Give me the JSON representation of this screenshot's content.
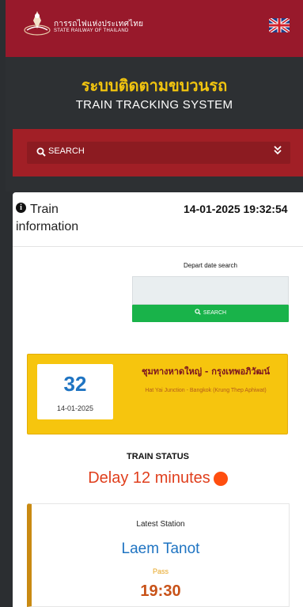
{
  "header": {
    "brand_th": "การรถไฟแห่งประเทศไทย",
    "brand_en": "STATE RAILWAY OF THAILAND",
    "logo_icon": "srt-logo",
    "lang_icon": "uk-flag-icon",
    "bar_color": "#98192b"
  },
  "hero": {
    "title_th": "ระบบติดตามขบวนรถ",
    "title_en": "TRAIN TRACKING SYSTEM",
    "title_color": "#f1c40f"
  },
  "search": {
    "label": "SEARCH",
    "icon": "search-icon",
    "toggle_icon": "double-chevron-down-icon"
  },
  "info": {
    "title": "Train information",
    "datetime": "14-01-2025 19:32:54",
    "icon": "info-circle-icon"
  },
  "depart": {
    "label": "Depart date search",
    "input_value": "",
    "button_label": "SEARCH",
    "button_color": "#19b34a"
  },
  "train": {
    "number": "32",
    "date": "14-01-2025",
    "route_th": "ชุมทางหาดใหญ่ - กรุงเทพอภิวัฒน์",
    "route_en": "Hat Yai Junction - Bangkok (Krung Thep Aphiwat)",
    "card_color": "#f6c50e"
  },
  "status": {
    "label": "TRAIN STATUS",
    "text": "Delay 12 minutes",
    "color": "#e03f1d"
  },
  "latest": {
    "label": "Latest Station",
    "station": "Laem Tanot",
    "state": "Pass",
    "time": "19:30"
  }
}
